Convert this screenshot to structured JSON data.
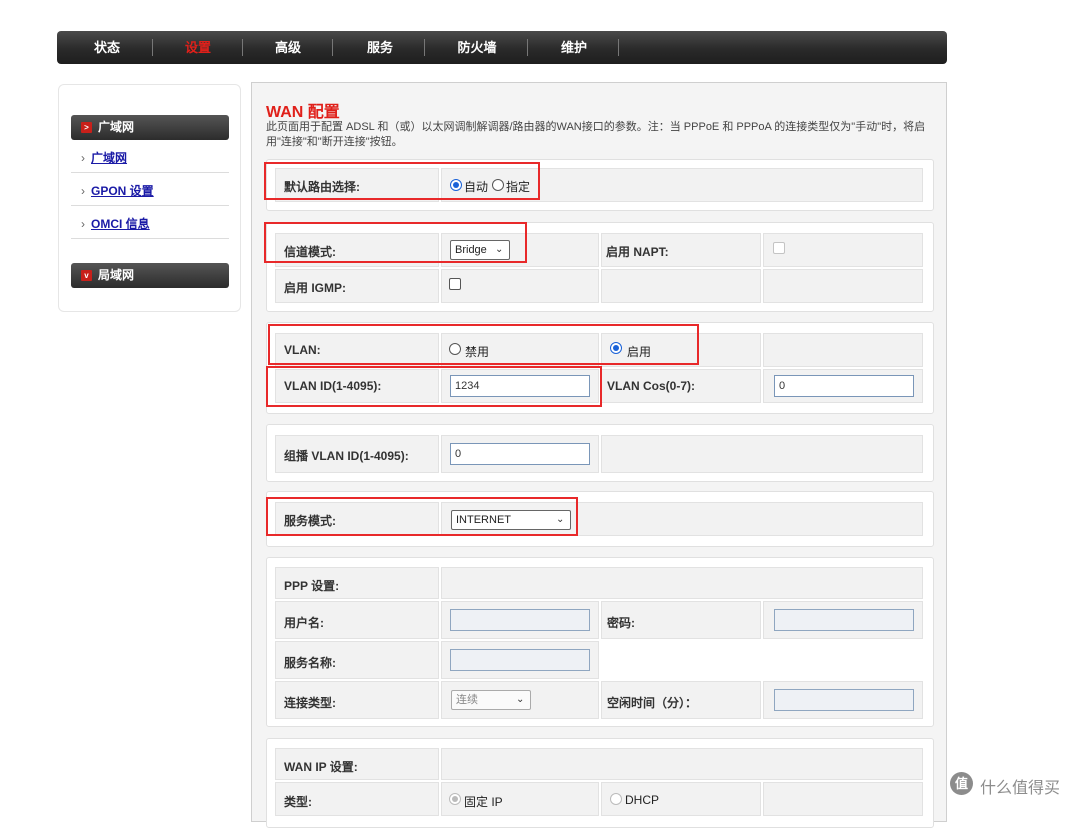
{
  "nav": {
    "tabs": [
      "状态",
      "设置",
      "高级",
      "服务",
      "防火墙",
      "维护"
    ],
    "active": "设置"
  },
  "sidebar": {
    "groups": [
      {
        "label": "广域网",
        "links": [
          "广域网",
          "GPON 设置",
          "OMCI 信息"
        ]
      },
      {
        "label": "局域网",
        "links": []
      }
    ]
  },
  "page": {
    "title": "WAN 配置",
    "description": "此页面用于配置 ADSL 和（或）以太网调制解调器/路由器的WAN接口的参数。注：当 PPPoE 和 PPPoA 的连接类型仅为\"手动\"时，将启用\"连接\"和\"断开连接\"按钮。"
  },
  "form": {
    "default_route": {
      "label": "默认路由选择:",
      "options": [
        "自动",
        "指定"
      ],
      "selected": "自动"
    },
    "channel_mode": {
      "label": "信道模式:",
      "value": "Bridge"
    },
    "napt": {
      "label": "启用 NAPT:"
    },
    "igmp": {
      "label": "启用 IGMP:"
    },
    "vlan": {
      "label": "VLAN:",
      "options": [
        "禁用",
        "启用"
      ],
      "selected": "启用"
    },
    "vlan_id": {
      "label": "VLAN ID(1-4095):",
      "value": "1234"
    },
    "vlan_cos": {
      "label": "VLAN Cos(0-7):",
      "value": "0"
    },
    "multicast_vlan": {
      "label": "组播 VLAN ID(1-4095):",
      "value": "0"
    },
    "service_mode": {
      "label": "服务模式:",
      "value": "INTERNET"
    },
    "ppp": {
      "heading": "PPP 设置:",
      "username_label": "用户名:",
      "password_label": "密码:",
      "service_name_label": "服务名称:",
      "conn_type_label": "连接类型:",
      "conn_type_value": "连续",
      "idle_time_label": "空闲时间（分）："
    },
    "wan_ip": {
      "heading": "WAN IP 设置:",
      "type_label": "类型:",
      "options": [
        "固定 IP",
        "DHCP"
      ],
      "selected": "固定 IP"
    }
  },
  "watermark": "什么值得买"
}
